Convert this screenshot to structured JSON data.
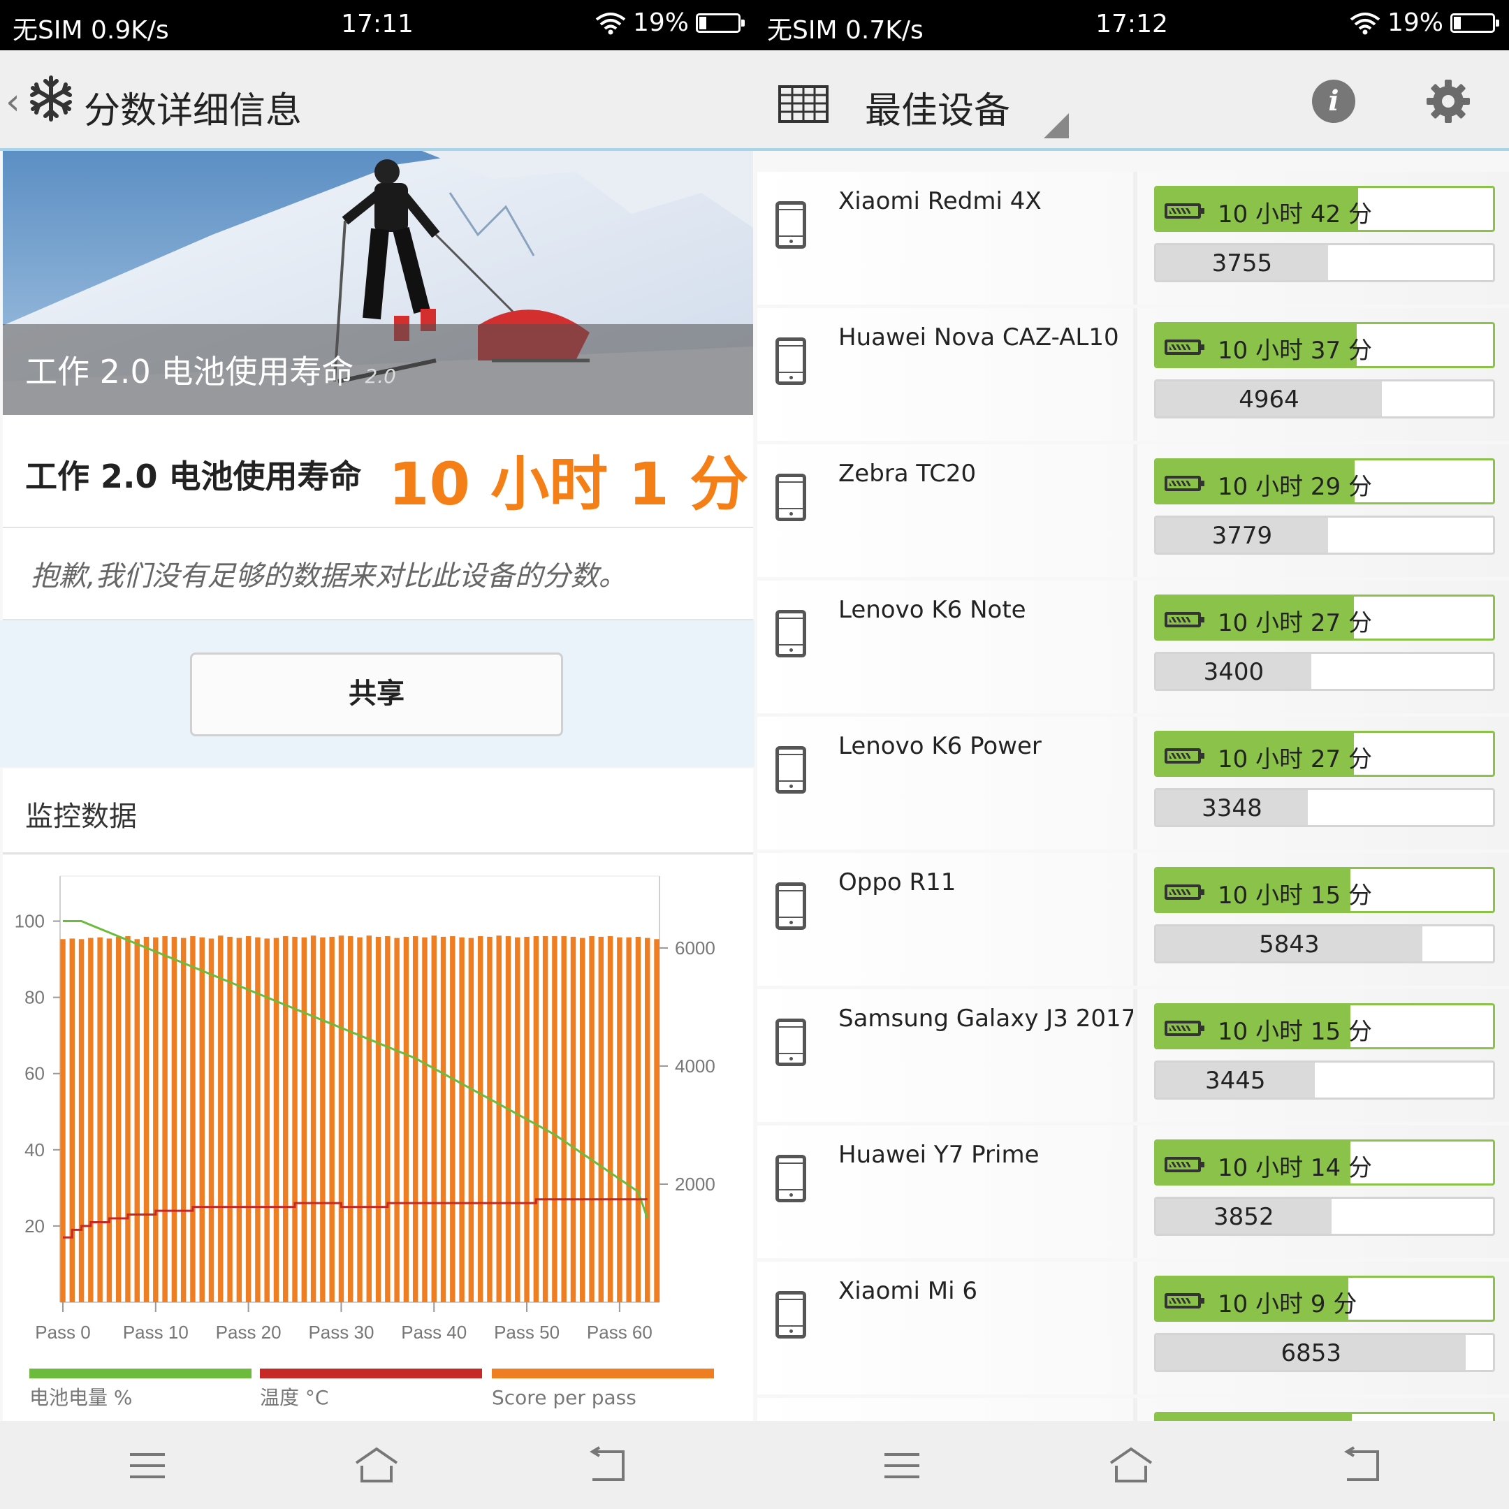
{
  "left": {
    "status": {
      "carrier": "无SIM",
      "speed": "0.9K/s",
      "time": "17:11",
      "battery": "19%"
    },
    "header": {
      "title": "分数详细信息"
    },
    "hero": {
      "title": "工作 2.0 电池使用寿命",
      "version": "2.0"
    },
    "score": {
      "label": "工作 2.0 电池使用寿命",
      "value": "10 小时 1 分"
    },
    "notice": "抱歉,我们没有足够的数据来对比此设备的分数。",
    "share_label": "共享",
    "monitor_title": "监控数据",
    "chart_data": {
      "type": "bar+line",
      "left_axis_ticks": [
        "100",
        "80",
        "60",
        "40",
        "20"
      ],
      "right_axis_ticks": [
        "6000",
        "4000",
        "2000"
      ],
      "left_ylim": [
        0,
        110
      ],
      "right_ylim": [
        0,
        7100
      ],
      "x_ticks": [
        "Pass 0",
        "Pass 10",
        "Pass 20",
        "Pass 30",
        "Pass 40",
        "Pass 50",
        "Pass 60"
      ],
      "x_range": [
        0,
        64
      ],
      "legend": [
        {
          "label": "电池电量 %",
          "color": "#6dbb3c"
        },
        {
          "label": "温度 °C",
          "color": "#c62828"
        },
        {
          "label": "Score per pass",
          "color": "#ef7d22"
        }
      ],
      "score_per_pass": [
        6150,
        6160,
        6150,
        6170,
        6180,
        6160,
        6190,
        6200,
        6150,
        6190,
        6180,
        6200,
        6190,
        6170,
        6200,
        6180,
        6160,
        6210,
        6190,
        6170,
        6200,
        6180,
        6160,
        6170,
        6200,
        6190,
        6180,
        6210,
        6180,
        6190,
        6210,
        6200,
        6180,
        6210,
        6190,
        6200,
        6170,
        6190,
        6200,
        6180,
        6210,
        6190,
        6200,
        6180,
        6170,
        6200,
        6190,
        6210,
        6200,
        6180,
        6190,
        6200,
        6200,
        6200,
        6200,
        6190,
        6170,
        6200,
        6190,
        6200,
        6180,
        6180,
        6190,
        6170,
        6150
      ],
      "battery_pct": [
        [
          0,
          100
        ],
        [
          2,
          100
        ],
        [
          5,
          97
        ],
        [
          8,
          94
        ],
        [
          11,
          91
        ],
        [
          14,
          88
        ],
        [
          17,
          85
        ],
        [
          20,
          82
        ],
        [
          23,
          79
        ],
        [
          26,
          76
        ],
        [
          29,
          73
        ],
        [
          32,
          70
        ],
        [
          35,
          67
        ],
        [
          38,
          64
        ],
        [
          41,
          60
        ],
        [
          44,
          56
        ],
        [
          47,
          52
        ],
        [
          50,
          48
        ],
        [
          53,
          44
        ],
        [
          56,
          39
        ],
        [
          59,
          34
        ],
        [
          62,
          29
        ],
        [
          63,
          22
        ]
      ],
      "temperature_c": [
        [
          0,
          17
        ],
        [
          1,
          19
        ],
        [
          2,
          20
        ],
        [
          3,
          21
        ],
        [
          5,
          22
        ],
        [
          7,
          23
        ],
        [
          10,
          24
        ],
        [
          14,
          25
        ],
        [
          24,
          25
        ],
        [
          25,
          26
        ],
        [
          29,
          26
        ],
        [
          30,
          25
        ],
        [
          34,
          25
        ],
        [
          35,
          26
        ],
        [
          50,
          26
        ],
        [
          51,
          27
        ],
        [
          63,
          27
        ]
      ]
    }
  },
  "right": {
    "status": {
      "carrier": "无SIM",
      "speed": "0.7K/s",
      "time": "17:12",
      "battery": "19%"
    },
    "header": {
      "title": "最佳设备"
    },
    "devices": [
      {
        "name": "Xiaomi Redmi 4X",
        "time": "10 小时 42 分",
        "time_fill": 0.6,
        "score": "3755",
        "score_fill": 0.51
      },
      {
        "name": "Huawei Nova CAZ-AL10",
        "time": "10 小时 37 分",
        "time_fill": 0.595,
        "score": "4964",
        "score_fill": 0.67
      },
      {
        "name": "Zebra TC20",
        "time": "10 小时 29 分",
        "time_fill": 0.59,
        "score": "3779",
        "score_fill": 0.51
      },
      {
        "name": "Lenovo K6 Note",
        "time": "10 小时 27 分",
        "time_fill": 0.588,
        "score": "3400",
        "score_fill": 0.46
      },
      {
        "name": "Lenovo K6 Power",
        "time": "10 小时 27 分",
        "time_fill": 0.588,
        "score": "3348",
        "score_fill": 0.45
      },
      {
        "name": "Oppo R11",
        "time": "10 小时 15 分",
        "time_fill": 0.577,
        "score": "5843",
        "score_fill": 0.79
      },
      {
        "name": "Samsung Galaxy J3 2017",
        "time": "10 小时 15 分",
        "time_fill": 0.577,
        "score": "3445",
        "score_fill": 0.47
      },
      {
        "name": "Huawei Y7 Prime",
        "time": "10 小时 14 分",
        "time_fill": 0.576,
        "score": "3852",
        "score_fill": 0.52
      },
      {
        "name": "Xiaomi Mi 6",
        "time": "10 小时 9 分",
        "time_fill": 0.571,
        "score": "6853",
        "score_fill": 0.92
      }
    ]
  }
}
